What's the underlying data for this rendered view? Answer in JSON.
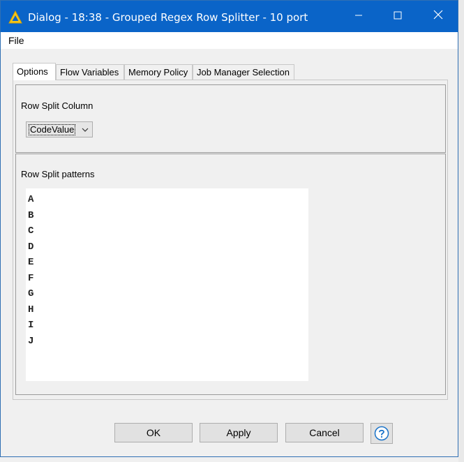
{
  "window": {
    "title": "Dialog - 18:38 - Grouped Regex Row Splitter - 10 port",
    "title_icon": "knime-triangle-icon",
    "controls": {
      "minimize": "—",
      "maximize": "☐",
      "close": "✕"
    }
  },
  "menubar": {
    "file_label": "File"
  },
  "tabs": [
    {
      "label": "Options",
      "active": true
    },
    {
      "label": "Flow Variables",
      "active": false
    },
    {
      "label": "Memory Policy",
      "active": false
    },
    {
      "label": "Job Manager Selection",
      "active": false
    }
  ],
  "options": {
    "split_column": {
      "label": "Row Split Column",
      "selected_value": "CodeValue"
    },
    "split_patterns": {
      "label": "Row Split patterns",
      "lines": [
        "A",
        "B",
        "C",
        "D",
        "E",
        "F",
        "G",
        "H",
        "I",
        "J"
      ]
    }
  },
  "buttons": {
    "ok_label": "OK",
    "apply_label": "Apply",
    "cancel_label": "Cancel",
    "help_icon": "help-question-icon"
  },
  "colors": {
    "titlebar": "#0a64c8",
    "accent_help": "#1a73c9"
  }
}
